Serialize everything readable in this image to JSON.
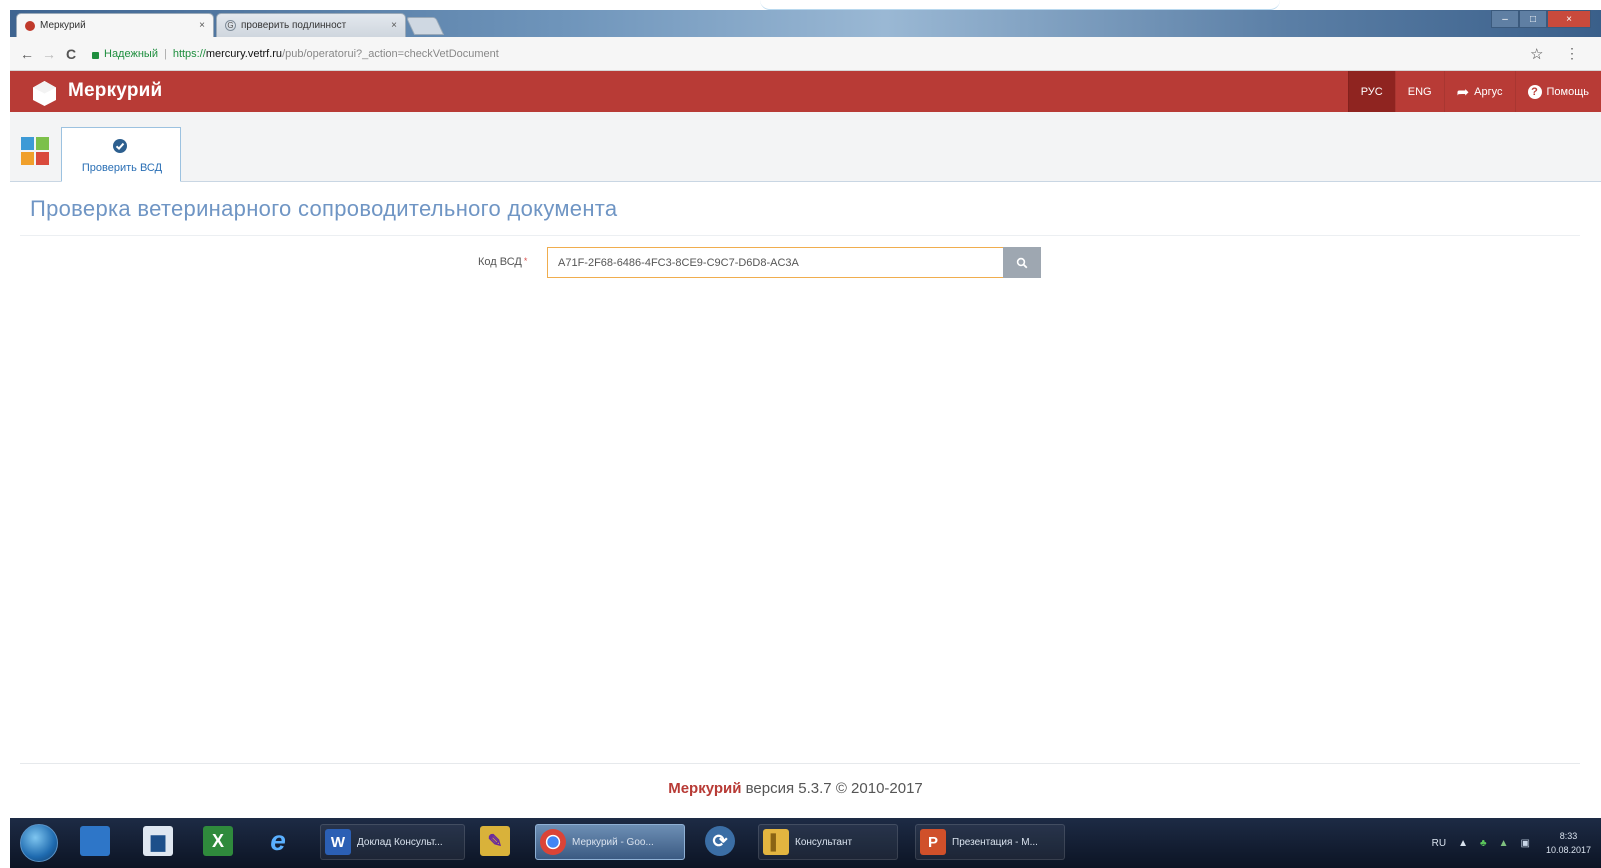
{
  "browser": {
    "tabs": [
      {
        "title": "Меркурий",
        "active": true
      },
      {
        "title": "проверить подлинност",
        "active": false
      }
    ],
    "tab_close_glyph": "×",
    "window_controls": [
      "–",
      "□",
      "×"
    ],
    "security_label": "Надежный",
    "url_scheme": "https://",
    "url_host": "mercury.vetrf.ru",
    "url_path": "/pub/operatorui?_action=checkVetDocument",
    "nav": {
      "back": "←",
      "forward": "→",
      "reload": "C"
    },
    "star_glyph": "☆",
    "menu_glyph": "⋮"
  },
  "header": {
    "app_title": "Меркурий",
    "nav": [
      {
        "label": "РУС",
        "active": true
      },
      {
        "label": "ENG",
        "active": false
      },
      {
        "label": "Аргус",
        "icon": "share-icon",
        "icon_glyph": "➦"
      },
      {
        "label": "Помощь",
        "icon": "help-icon",
        "icon_glyph": "?"
      }
    ],
    "color": "#b83b36"
  },
  "toolbar": {
    "tab_label": "Проверить ВСД",
    "tab_icon": "check-circle-icon"
  },
  "page": {
    "title": "Проверка ветеринарного сопроводительного документа",
    "field_label": "Код ВСД",
    "required_mark": "*",
    "field_value": "A71F-2F68-6486-4FC3-8CE9-C9C7-D6D8-AC3A",
    "search_icon": "search-icon"
  },
  "footer": {
    "brand": "Меркурий",
    "text": " версия 5.3.7 © 2010-2017"
  },
  "taskbar": {
    "apps": [
      {
        "label": "Доклад Консульт...",
        "icon": "word-icon",
        "icon_glyph": "W"
      },
      {
        "label": "Меркурий - Goo...",
        "icon": "chrome-icon",
        "icon_glyph": "",
        "active": true
      },
      {
        "label": "Консультант",
        "icon": "folder-icon",
        "icon_glyph": "▌"
      },
      {
        "label": "Презентация - M...",
        "icon": "powerpoint-icon",
        "icon_glyph": "P"
      }
    ],
    "tray_lang": "RU",
    "tray_up": "▲",
    "time": "8:33",
    "date": "10.08.2017"
  }
}
